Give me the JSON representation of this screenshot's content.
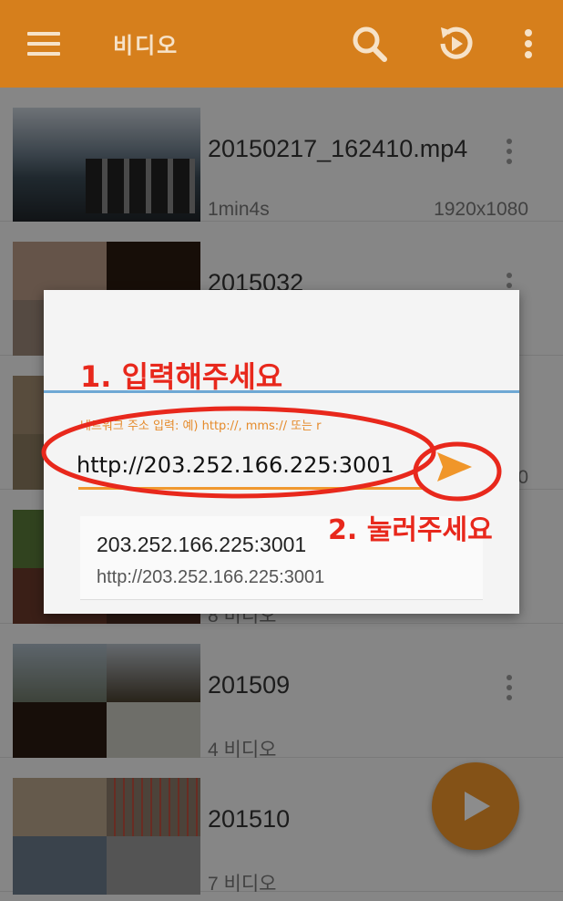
{
  "appbar": {
    "title": "비디오",
    "icons": [
      "menu-icon",
      "search-icon",
      "history-icon",
      "more-vert-icon"
    ]
  },
  "list": {
    "items": [
      {
        "name": "20150217_162410.mp4",
        "meta": "1min4s",
        "resolution": "1920x1080"
      },
      {
        "name": "2015032",
        "meta": "",
        "resolution": ""
      },
      {
        "name": "",
        "meta": "",
        "resolution": "0"
      },
      {
        "name": "",
        "meta": "8 비디오",
        "resolution": ""
      },
      {
        "name": "201509",
        "meta": "4 비디오",
        "resolution": ""
      },
      {
        "name": "201510",
        "meta": "7 비디오",
        "resolution": ""
      }
    ]
  },
  "dialog": {
    "hint": "네트워크 주소 입력: 예) http://, mms:// 또는 r",
    "url_value": "http://203.252.166.225:3001",
    "suggestion": {
      "title": "203.252.166.225:3001",
      "subtitle": "http://203.252.166.225:3001"
    }
  },
  "annotations": {
    "step1": "1. 입력해주세요",
    "step2": "2. 눌러주세요",
    "color": "#e8281c"
  },
  "colors": {
    "appbar": "#d67f1c",
    "accent": "#f0962a"
  }
}
